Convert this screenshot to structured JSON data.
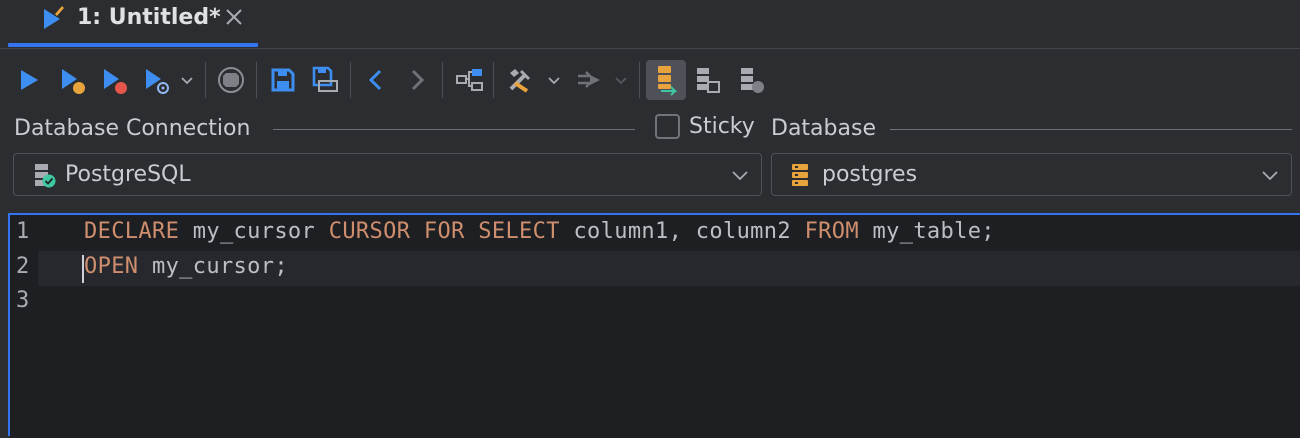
{
  "tab": {
    "title": "1: Untitled*"
  },
  "connection": {
    "label": "Database Connection",
    "sticky_label": "Sticky",
    "database_label": "Database",
    "selected_connection": "PostgreSQL",
    "selected_database": "postgres"
  },
  "editor": {
    "line_numbers": [
      "1",
      "2",
      "3"
    ],
    "lines": [
      [
        {
          "t": "DECLARE",
          "kw": true
        },
        {
          "t": " my_cursor ",
          "kw": false
        },
        {
          "t": "CURSOR FOR SELECT",
          "kw": true
        },
        {
          "t": " column1, column2 ",
          "kw": false
        },
        {
          "t": "FROM",
          "kw": true
        },
        {
          "t": " my_table;",
          "kw": false
        }
      ],
      [
        {
          "t": "OPEN",
          "kw": true
        },
        {
          "t": " my_cursor;",
          "kw": false
        }
      ],
      []
    ]
  },
  "colors": {
    "accent": "#3574f0",
    "keyword": "#cf8e6d",
    "warning_orange": "#e8a33d"
  },
  "icons": [
    "script-icon",
    "close-icon",
    "run-icon",
    "run-statement-icon",
    "run-selection-icon",
    "run-options-icon",
    "stop-icon",
    "save-icon",
    "save-all-icon",
    "back-icon",
    "forward-icon",
    "explain-plan-icon",
    "tools-icon",
    "transfer-icon",
    "tree-view-icon",
    "results-sql-icon",
    "results-params-icon",
    "database-icon",
    "postgres-icon"
  ]
}
